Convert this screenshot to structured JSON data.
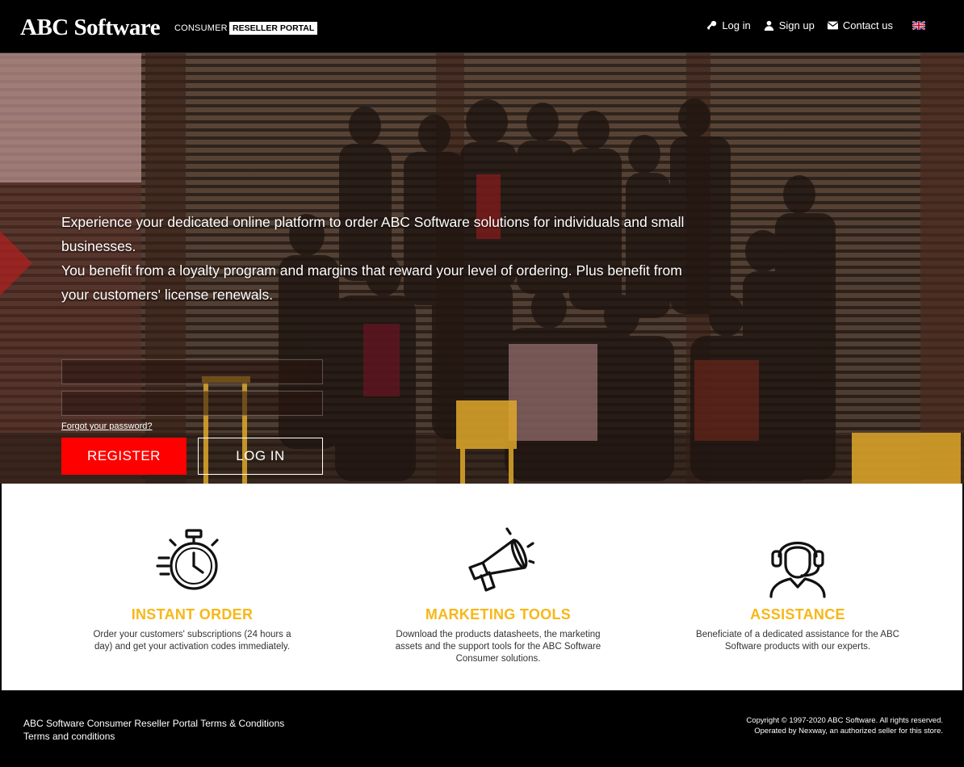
{
  "header": {
    "logo": "ABC Software",
    "logo_sub": "CONSUMER",
    "logo_badge": "RESELLER PORTAL",
    "nav": {
      "login": "Log in",
      "signup": "Sign up",
      "contact": "Contact us"
    },
    "language_icon": "uk-flag-icon"
  },
  "hero": {
    "line1": "Experience your dedicated online platform to order ABC Software solutions for individuals and small businesses.",
    "line2": "You benefit from a loyalty program and margins that reward your level of ordering. Plus benefit from your customers' license renewals.",
    "form": {
      "username_value": "",
      "password_value": "",
      "forgot_password": "Forgot your password?",
      "register_label": "REGISTER",
      "login_label": "LOG IN"
    }
  },
  "features": [
    {
      "icon": "stopwatch-icon",
      "title": "INSTANT ORDER",
      "description": "Order your customers' subscriptions (24 hours a day) and get your activation codes immediately."
    },
    {
      "icon": "megaphone-icon",
      "title": "MARKETING TOOLS",
      "description": "Download the products datasheets, the marketing assets and the support tools for the ABC Software Consumer solutions."
    },
    {
      "icon": "headset-agent-icon",
      "title": "ASSISTANCE",
      "description": "Beneficiate of a dedicated assistance for the ABC Software products with our experts."
    }
  ],
  "footer": {
    "link1": "ABC Software Consumer Reseller Portal Terms & Conditions",
    "link2": "Terms and conditions",
    "copyright": "Copyright © 1997-2020  ABC Software. All rights reserved.",
    "operated": "Operated by Nexway, an authorized seller for this store."
  },
  "colors": {
    "accent_red": "#ff0000",
    "feature_yellow": "#f7b718",
    "header_bg": "#000000"
  }
}
